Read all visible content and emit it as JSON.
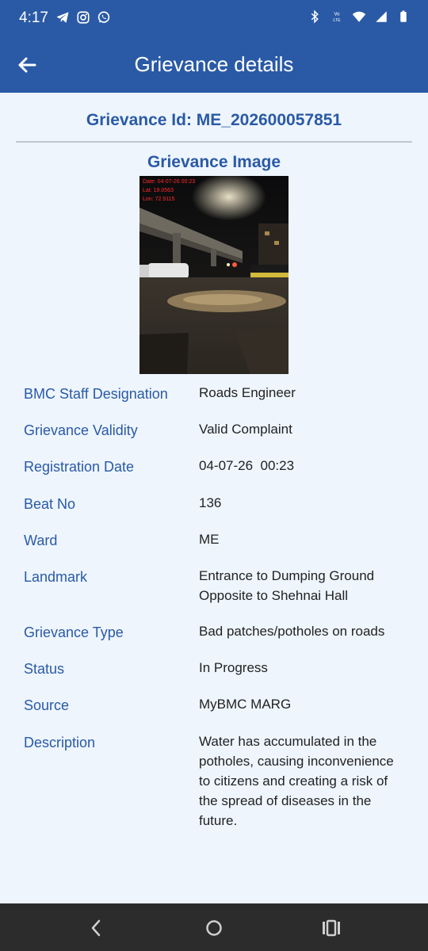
{
  "status_bar": {
    "time": "4:17",
    "left_icons": [
      "telegram-icon",
      "instagram-icon",
      "whatsapp-icon"
    ],
    "right_icons": [
      "bluetooth-icon",
      "volte-icon",
      "wifi-icon",
      "signal-icon",
      "battery-icon"
    ],
    "volte_label": "VoLTE"
  },
  "app_bar": {
    "title": "Grievance details",
    "back_icon": "arrow-back-icon"
  },
  "grievance": {
    "id_text": "Grievance Id: ME_202600057851",
    "image_title": "Grievance Image",
    "image_overlay_lines": [
      "Date: 04-07-26 00:23",
      "Lat: 19.0563",
      "Lon: 72.9115"
    ]
  },
  "details": [
    {
      "label": "BMC Staff Designation",
      "value": "Roads Engineer"
    },
    {
      "label": "Grievance Validity",
      "value": "Valid Complaint"
    },
    {
      "label": "Registration Date",
      "value": "04-07-26  00:23"
    },
    {
      "label": "Beat No",
      "value": "136"
    },
    {
      "label": "Ward",
      "value": "ME"
    },
    {
      "label": "Landmark",
      "value": "Entrance to Dumping Ground Opposite to Shehnai Hall"
    },
    {
      "label": "Grievance Type",
      "value": "Bad patches/potholes on roads"
    },
    {
      "label": "Status",
      "value": "In Progress"
    },
    {
      "label": "Source",
      "value": "MyBMC MARG"
    },
    {
      "label": "Description",
      "value": "Water has accumulated in the potholes, causing inconvenience to citizens and creating a risk of the spread of diseases in the future."
    }
  ],
  "nav_bar": {
    "buttons": [
      "back-nav-icon",
      "home-nav-icon",
      "recents-nav-icon"
    ]
  },
  "colors": {
    "primary": "#2a5aa6",
    "background": "#eef5fd",
    "nav_bar": "#2c2c2c",
    "overlay_text": "#ff2a2a"
  }
}
